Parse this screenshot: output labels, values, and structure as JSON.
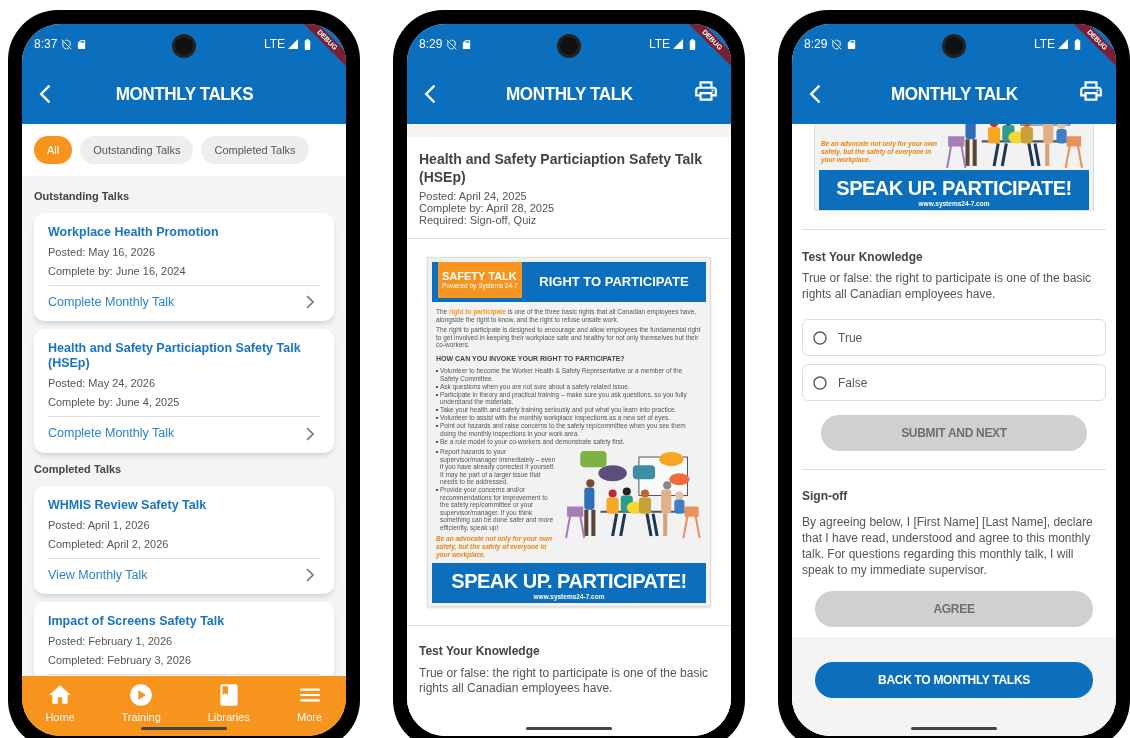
{
  "list_screen": {
    "status_bar": {
      "time": "8:37",
      "network": "LTE",
      "debug_banner": "DEBUG"
    },
    "app_bar": {
      "title": "MONTHLY TALKS",
      "print_button": false
    },
    "filters": [
      {
        "label": "All",
        "selected": true
      },
      {
        "label": "Outstanding Talks",
        "selected": false
      },
      {
        "label": "Completed Talks",
        "selected": false
      }
    ],
    "sections": [
      {
        "heading": "Outstanding Talks",
        "cards": [
          {
            "title": "Workplace Health Promotion",
            "posted": "Posted: May 16, 2026",
            "due": "Complete by: June 16, 2024",
            "link": "Complete Monthly Talk"
          },
          {
            "title": "Health and Safety Particiaption Safety Talk (HSEp)",
            "posted": "Posted: May 24, 2026",
            "due": "Complete by: June 4, 2025",
            "link": "Complete Monthly Talk"
          }
        ]
      },
      {
        "heading": "Completed Talks",
        "cards": [
          {
            "title": "WHMIS Review Safety Talk",
            "posted": "Posted: April 1, 2026",
            "due": "Completed: April 2, 2026",
            "link": "View Monthly Talk"
          },
          {
            "title": "Impact of Screens Safety Talk",
            "posted": "Posted: February 1, 2026",
            "due": "Completed: February 3, 2026"
          }
        ]
      }
    ],
    "bottom_nav": [
      {
        "kind": "home",
        "label": "Home"
      },
      {
        "kind": "training",
        "label": "Training"
      },
      {
        "kind": "libraries",
        "label": "Libraries"
      },
      {
        "kind": "more",
        "label": "More"
      }
    ]
  },
  "detail_screen": {
    "status_bar": {
      "time": "8:29",
      "network": "LTE",
      "debug_banner": "DEBUG"
    },
    "app_bar": {
      "title": "MONTHLY TALK",
      "print_button": true
    },
    "talk": {
      "title": "Health and Safety Particiaption Safety Talk (HSEp)",
      "posted": "Posted: April 24, 2025",
      "complete_by": "Complete by: April 28, 2025",
      "required": "Required: Sign-off, Quiz"
    },
    "poster": {
      "tag": "SAFETY TALK",
      "tagline": "Powered by Systems 24-7",
      "title": "RIGHT TO PARTICIPATE",
      "paragraphs": [
        "The **right to participate** is one of the three basic rights that all Canadian employees have, alongside the right to know, and the right to refuse unsafe work.",
        "The right to participate is designed to encourage and allow employees the fundamental right to get involved in keeping their workplace safe and healthy for not only themselves but their co-workers."
      ],
      "heading": "HOW CAN YOU INVOKE YOUR RIGHT TO PARTICIPATE?",
      "bullets": [
        "Volunteer to become the Worker Health & Safety Representative or a member of the Safety Committee.",
        "Ask questions when you are not sure about a safety related issue.",
        "Participate in theory and practical training – make sure you ask questions, so you fully understand the materials.",
        "Take your health and safety training seriously and put what you learn into practice.",
        "Volunteer to assist with the monthly workplace inspections as a new set of eyes.",
        "Point out hazards and raise concerns to the safety rep/committee when you see them doing the monthly inspections in your work area.",
        "Be a role model to your co-workers and demonstrate safety first.",
        "Report hazards to your supervisor/manager immediately – even if you have already corrected it yourself. It may be part of a larger issue that needs to be addressed.",
        "Provide your concerns and/or recommendations for improvement to the safety rep/committee or your supervisor/manager. If you think something can be done safer and more efficiently, speak up!"
      ],
      "advocate": "Be an advocate not only for your own safety, but the safety of everyone in your workplace.",
      "banner": "SPEAK UP. PARTICIPATE!",
      "url": "www.systems24-7.com"
    },
    "quiz": {
      "heading": "Test Your Knowledge",
      "question": "True or false: the right to participate is one of the basic rights all Canadian employees have."
    }
  },
  "quiz_screen": {
    "status_bar": {
      "time": "8:29",
      "network": "LTE",
      "debug_banner": "DEBUG"
    },
    "app_bar": {
      "title": "MONTHLY TALK",
      "print_button": true
    },
    "poster_bottom": {
      "advocate": "Be an advocate not only for your own safety, but the safety of everyone in your workplace.",
      "banner": "SPEAK UP. PARTICIPATE!",
      "url": "www.systems24-7.com"
    },
    "quiz": {
      "heading": "Test Your Knowledge",
      "question": "True or false: the right to participate is one of the basic rights all Canadian employees have.",
      "options": [
        {
          "label": "True",
          "selected": false
        },
        {
          "label": "False",
          "selected": false
        }
      ],
      "submit": {
        "label": "SUBMIT AND NEXT",
        "disabled": true
      }
    },
    "sign_off": {
      "heading": "Sign-off",
      "text": "By agreeing below, I [First Name] [Last Name], declare that I have read, understood and agree to this monthly talk. For questions regarding this monthly talk, I will speak to my immediate supervisor.",
      "agree": {
        "label": "AGREE",
        "disabled": true
      }
    },
    "back_button": "BACK TO MONTHLY TALKS"
  }
}
